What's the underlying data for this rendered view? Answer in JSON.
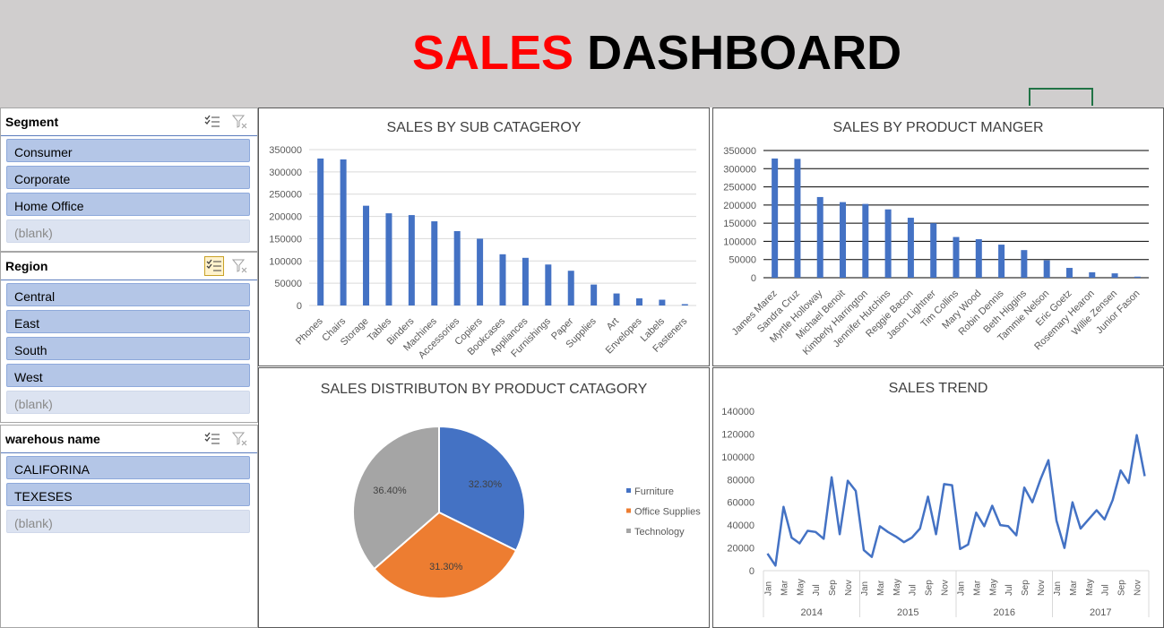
{
  "header": {
    "title_part1": "SALES",
    "title_part2": "DASHBOARD"
  },
  "slicers": {
    "segment": {
      "title": "Segment",
      "items": [
        "Consumer",
        "Corporate",
        "Home Office"
      ],
      "blank": "(blank)"
    },
    "region": {
      "title": "Region",
      "items": [
        "Central",
        "East",
        "South",
        "West"
      ],
      "blank": "(blank)"
    },
    "warehouse": {
      "title": "warehous name",
      "items": [
        "CALIFORINA",
        "TEXESES"
      ],
      "blank": "(blank)"
    }
  },
  "icons": {
    "multi_select": "multi-select-icon",
    "clear_filter": "clear-filter-icon"
  },
  "colors": {
    "bar": "#4472c4",
    "furniture": "#4472c4",
    "office": "#ed7d31",
    "technology": "#a5a5a5",
    "title_red": "#ff0000"
  },
  "chart_data": [
    {
      "type": "bar",
      "title": "SALES BY SUB CATAGEROY",
      "categories": [
        "Phones",
        "Chairs",
        "Storage",
        "Tables",
        "Binders",
        "Machines",
        "Accessories",
        "Copiers",
        "Bookcases",
        "Appliances",
        "Furnishings",
        "Paper",
        "Supplies",
        "Art",
        "Envelopes",
        "Labels",
        "Fasteners"
      ],
      "values": [
        330000,
        328000,
        224000,
        207000,
        203000,
        189000,
        167000,
        150000,
        115000,
        107000,
        92000,
        78000,
        47000,
        27000,
        16000,
        13000,
        3000
      ],
      "ylim": [
        0,
        350000
      ],
      "yticks": [
        "0",
        "50000",
        "100000",
        "150000",
        "200000",
        "250000",
        "300000",
        "350000"
      ],
      "grid": true
    },
    {
      "type": "bar",
      "title": "SALES BY PRODUCT MANGER",
      "categories": [
        "James Marez",
        "Sandra Cruz",
        "Myrtle Holloway",
        "Michael Benoit",
        "Kimberly Harrington",
        "Jennifer Hutchins",
        "Reggie Bacon",
        "Jason Lightner",
        "Tim Collins",
        "Mary Wood",
        "Robin Dennis",
        "Beth Higgins",
        "Tammie Nelson",
        "Eric Goetz",
        "Rosemary Hearon",
        "Willie Zensen",
        "Junior Fason"
      ],
      "values": [
        328000,
        327000,
        222000,
        208000,
        203000,
        188000,
        165000,
        150000,
        112000,
        106000,
        91000,
        76000,
        48000,
        27000,
        15000,
        12000,
        3000
      ],
      "ylim": [
        0,
        350000
      ],
      "yticks": [
        "0",
        "50000",
        "100000",
        "150000",
        "200000",
        "250000",
        "300000",
        "350000"
      ],
      "grid": true
    },
    {
      "type": "pie",
      "title": "SALES DISTRIBUTON BY PRODUCT CATAGORY",
      "slices": [
        {
          "label": "Furniture",
          "value": 32.3,
          "text": "32.30%"
        },
        {
          "label": "Office Supplies",
          "value": 31.3,
          "text": "31.30%"
        },
        {
          "label": "Technology",
          "value": 36.4,
          "text": "36.40%"
        }
      ],
      "legend": "right"
    },
    {
      "type": "line",
      "title": "SALES TREND",
      "years": [
        "2014",
        "2015",
        "2016",
        "2017"
      ],
      "month_labels": [
        "Jan",
        "Mar",
        "May",
        "Jul",
        "Sep",
        "Nov"
      ],
      "values": [
        15000,
        4500,
        56000,
        29000,
        24000,
        35000,
        34000,
        28000,
        82000,
        32000,
        79000,
        70000,
        18000,
        12000,
        39000,
        34000,
        30000,
        25000,
        29000,
        37000,
        65000,
        32000,
        76000,
        75000,
        19000,
        23000,
        51000,
        39000,
        57000,
        40000,
        39000,
        31000,
        73000,
        60000,
        80000,
        97000,
        44000,
        20000,
        60000,
        37000,
        45000,
        53000,
        45000,
        62000,
        88000,
        77000,
        119000,
        83000
      ],
      "ylim": [
        0,
        140000
      ],
      "yticks": [
        "0",
        "20000",
        "40000",
        "60000",
        "80000",
        "100000",
        "120000",
        "140000"
      ]
    }
  ]
}
